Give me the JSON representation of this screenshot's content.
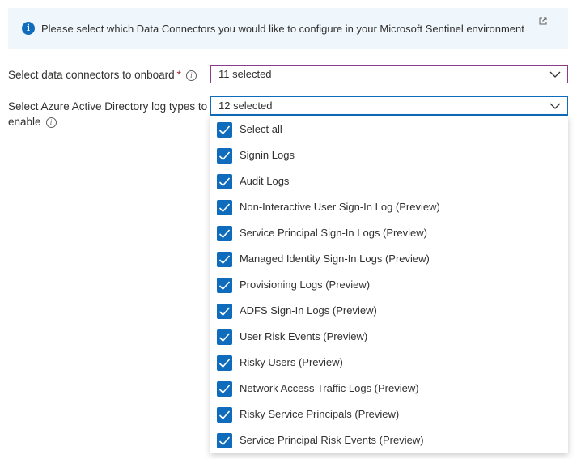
{
  "banner": {
    "text": "Please select which Data Connectors you would like to configure in your Microsoft Sentinel environment",
    "icon": "info-icon",
    "link_icon": "external-link-icon"
  },
  "connectors": {
    "label": "Select data connectors to onboard",
    "required_mark": "*",
    "value": "11 selected"
  },
  "aad_log_types": {
    "label_line1": "Select Azure Active Directory log types to",
    "label_line2": "enable",
    "value": "12 selected",
    "options": [
      {
        "label": "Select all",
        "checked": true
      },
      {
        "label": "Signin Logs",
        "checked": true
      },
      {
        "label": "Audit Logs",
        "checked": true
      },
      {
        "label": "Non-Interactive User Sign-In Log (Preview)",
        "checked": true
      },
      {
        "label": "Service Principal Sign-In Logs (Preview)",
        "checked": true
      },
      {
        "label": "Managed Identity Sign-In Logs (Preview)",
        "checked": true
      },
      {
        "label": "Provisioning Logs (Preview)",
        "checked": true
      },
      {
        "label": "ADFS Sign-In Logs (Preview)",
        "checked": true
      },
      {
        "label": "User Risk Events (Preview)",
        "checked": true
      },
      {
        "label": "Risky Users (Preview)",
        "checked": true
      },
      {
        "label": "Network Access Traffic Logs (Preview)",
        "checked": true
      },
      {
        "label": "Risky Service Principals (Preview)",
        "checked": true
      },
      {
        "label": "Service Principal Risk Events (Preview)",
        "checked": true
      }
    ]
  },
  "colors": {
    "accent": "#0f6cbd",
    "banner_bg": "#eff6fc",
    "required": "#a4262c",
    "dropdown1_border": "#8a3c8a"
  }
}
